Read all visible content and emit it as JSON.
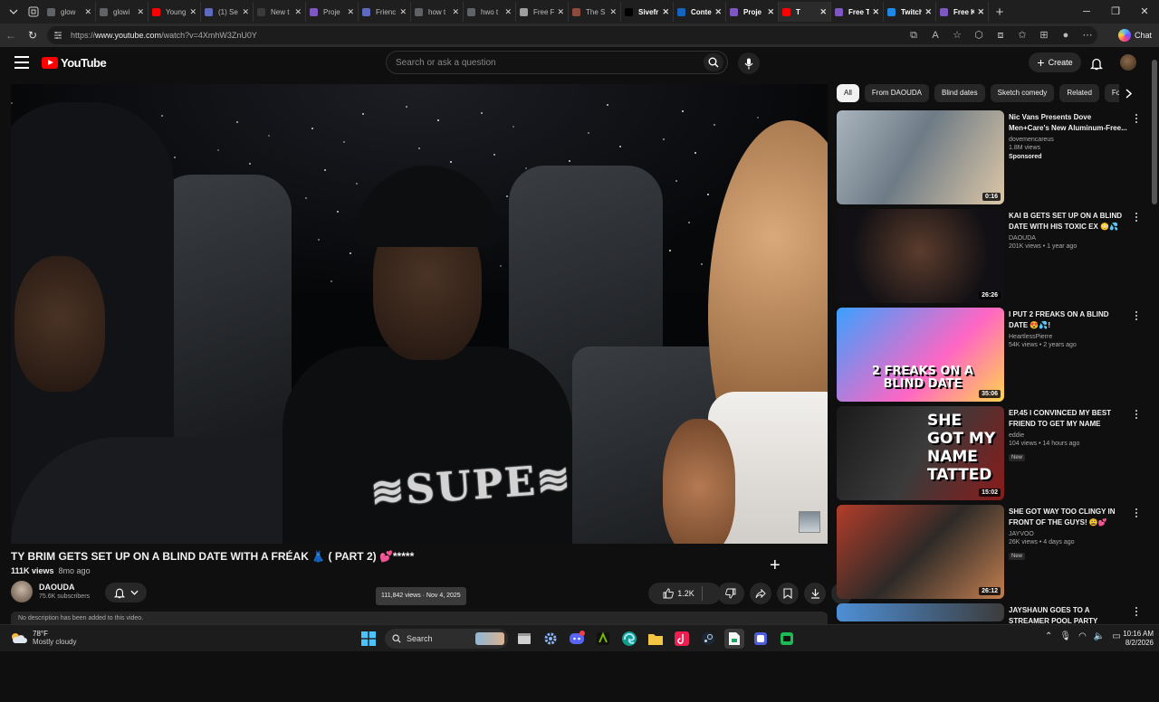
{
  "browser": {
    "tabs": [
      {
        "label": "glow",
        "color": "#5f6368"
      },
      {
        "label": "glowi",
        "color": "#5f6368"
      },
      {
        "label": "Young",
        "color": "#ff0000"
      },
      {
        "label": "(1) Se",
        "color": "#5c6bc0"
      },
      {
        "label": "New t",
        "color": "#3a3a3a"
      },
      {
        "label": "Proje",
        "color": "#7e57c2"
      },
      {
        "label": "Frienc",
        "color": "#5c6bc0"
      },
      {
        "label": "how t",
        "color": "#5f6368"
      },
      {
        "label": "hwo t",
        "color": "#5f6368"
      },
      {
        "label": "Free F",
        "color": "#9e9e9e"
      },
      {
        "label": "The S",
        "color": "#8d4b3c"
      },
      {
        "label": "Sivefr",
        "color": "#000000"
      },
      {
        "label": "Conte",
        "color": "#1565c0"
      },
      {
        "label": "Proje",
        "color": "#7e57c2"
      },
      {
        "label": "T",
        "color": "#ff0000"
      },
      {
        "label": "Free T",
        "color": "#7e57c2"
      },
      {
        "label": "Twitch",
        "color": "#1e88e5"
      },
      {
        "label": "Free K",
        "color": "#7e57c2"
      }
    ],
    "url_prefix": "https://",
    "url_domain": "www.youtube.com",
    "url_path": "/watch?v=4XmhW3ZnU0Y",
    "chat_label": "Chat"
  },
  "youtube": {
    "logo_text": "YouTube",
    "search_placeholder": "Search or ask a question",
    "create_label": "Create"
  },
  "video": {
    "title": "TY BRIM GETS SET UP ON A BLIND DATE WITH A FRÉAK 👗 ( PART 2) 💕*****",
    "views": "111K views",
    "age": "8mo ago",
    "channel": "DAOUDA",
    "subscribers": "75.6K subscribers",
    "tooltip": "111,842 views · Nov 4, 2025",
    "likes": "1.2K",
    "description": "No description has been added to this video."
  },
  "chips": [
    "All",
    "From DAOUDA",
    "Blind dates",
    "Sketch comedy",
    "Related",
    "Fo"
  ],
  "recommendations": [
    {
      "title": "Nic Vans Presents Dove Men+Care's New Aluminum-Free...",
      "channel": "dovemencareus",
      "meta": "1.8M views",
      "extra": "Sponsored",
      "duration": "0:16"
    },
    {
      "title": "KAI B GETS SET UP ON A BLIND DATE WITH HIS TOXIC EX 😳💦",
      "channel": "DAOUDA",
      "meta": "201K views • 1 year ago",
      "extra": "",
      "duration": "26:26"
    },
    {
      "title": "I PUT 2 FREAKS ON A BLIND DATE 😍💦!",
      "channel": "HeartlessPierre",
      "meta": "54K views • 2 years ago",
      "extra": "",
      "duration": "35:06",
      "thumb_text": "2 FREAKS ON A BLIND DATE"
    },
    {
      "title": "EP.45 I CONVINCED MY BEST FRIEND TO GET MY NAME TATTE...",
      "channel": "eddie",
      "meta": "104 views • 14 hours ago",
      "extra": "New",
      "duration": "15:02",
      "thumb_text": "SHE GOT MY NAME TATTED"
    },
    {
      "title": "SHE GOT WAY TOO CLINGY IN FRONT OF THE GUYS! 😩💕",
      "channel": "JAYVOO",
      "meta": "26K views • 4 days ago",
      "extra": "New",
      "duration": "26:12"
    },
    {
      "title": "JAYSHAUN GOES TO A STREAMER POOL PARTY",
      "channel": "",
      "meta": "",
      "extra": "",
      "duration": ""
    }
  ],
  "taskbar": {
    "temp": "78°F",
    "weather": "Mostly cloudy",
    "search_label": "Search",
    "time": "10:16 AM",
    "date": "8/2/2026"
  }
}
